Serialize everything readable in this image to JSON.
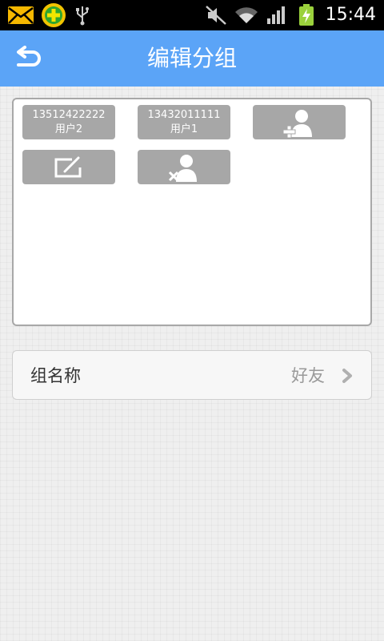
{
  "status_bar": {
    "time": "15:44",
    "icons": [
      "mail-icon",
      "security-app-icon",
      "usb-icon",
      "mute-icon",
      "wifi-icon",
      "signal-icon",
      "battery-charging-icon"
    ]
  },
  "header": {
    "title": "编辑分组",
    "back_icon": "back-arrow-icon"
  },
  "members": [
    {
      "phone": "13512422222",
      "name": "用户2"
    },
    {
      "phone": "13432011111",
      "name": "用户1"
    }
  ],
  "member_actions": [
    "add-contact-icon",
    "edit-icon",
    "remove-contact-icon"
  ],
  "group_name_row": {
    "label": "组名称",
    "value": "好友",
    "icon": "chevron-right-icon"
  },
  "colors": {
    "title_bar": "#5ba4f7",
    "tile": "#a7a7a7",
    "status_bar": "#000000"
  }
}
